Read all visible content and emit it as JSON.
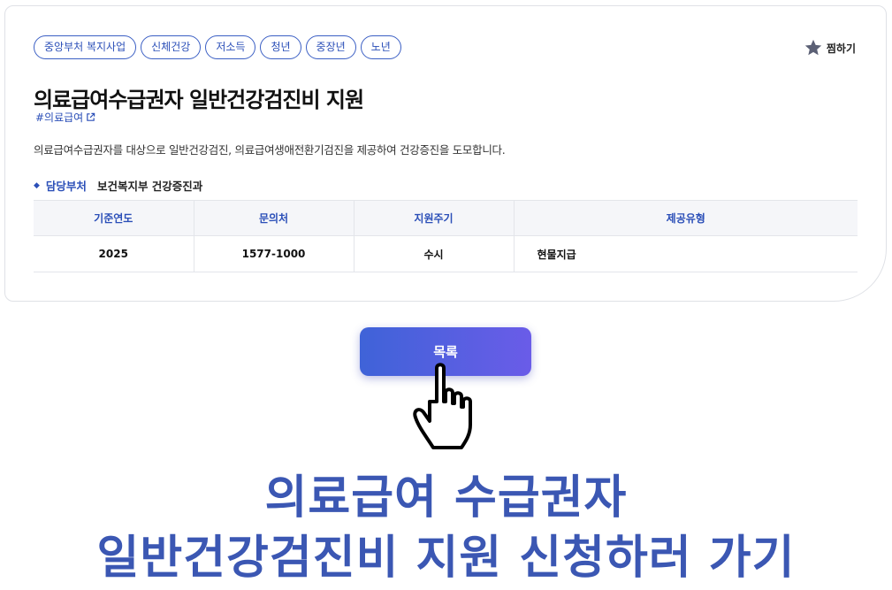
{
  "tags": [
    "중앙부처 복지사업",
    "신체건강",
    "저소득",
    "청년",
    "중장년",
    "노년"
  ],
  "bookmark_label": "찜하기",
  "title": "의료급여수급권자 일반건강검진비 지원",
  "hashtag": "#의료급여",
  "description": "의료급여수급권자를 대상으로 일반건강검진, 의료급여생애전환기검진을 제공하여 건강증진을 도모합니다.",
  "department": {
    "label": "담당부처",
    "value": "보건복지부 건강증진과"
  },
  "table": {
    "headers": [
      "기준연도",
      "문의처",
      "지원주기",
      "제공유형"
    ],
    "row": [
      "2025",
      "1577-1000",
      "수시",
      "현물지급"
    ]
  },
  "list_button_label": "목록",
  "caption": {
    "line1": "의료급여 수급권자",
    "line2": "일반건강검진비 지원 신청하러 가기"
  },
  "colors": {
    "accent": "#2b4fb8",
    "caption": "#3b57b3",
    "button_start": "#3f63d8",
    "button_end": "#6a5ce8"
  }
}
